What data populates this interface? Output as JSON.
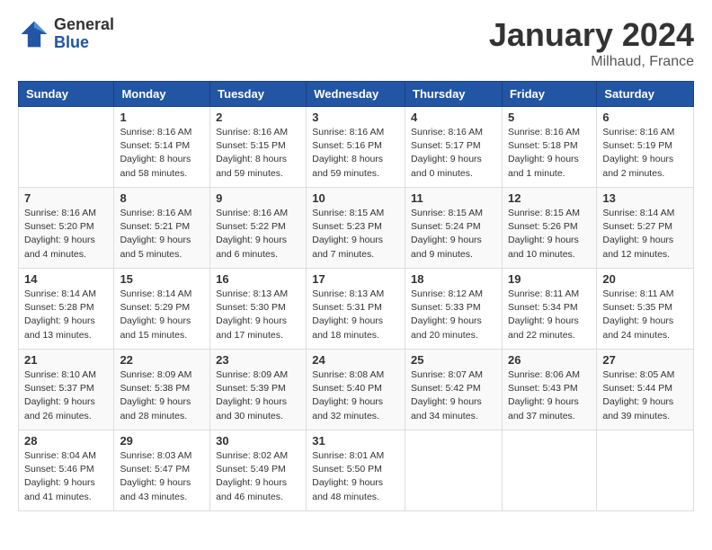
{
  "header": {
    "logo_general": "General",
    "logo_blue": "Blue",
    "month": "January 2024",
    "location": "Milhaud, France"
  },
  "weekdays": [
    "Sunday",
    "Monday",
    "Tuesday",
    "Wednesday",
    "Thursday",
    "Friday",
    "Saturday"
  ],
  "weeks": [
    [
      {
        "day": "",
        "sunrise": "",
        "sunset": "",
        "daylight": ""
      },
      {
        "day": "1",
        "sunrise": "Sunrise: 8:16 AM",
        "sunset": "Sunset: 5:14 PM",
        "daylight": "Daylight: 8 hours and 58 minutes."
      },
      {
        "day": "2",
        "sunrise": "Sunrise: 8:16 AM",
        "sunset": "Sunset: 5:15 PM",
        "daylight": "Daylight: 8 hours and 59 minutes."
      },
      {
        "day": "3",
        "sunrise": "Sunrise: 8:16 AM",
        "sunset": "Sunset: 5:16 PM",
        "daylight": "Daylight: 8 hours and 59 minutes."
      },
      {
        "day": "4",
        "sunrise": "Sunrise: 8:16 AM",
        "sunset": "Sunset: 5:17 PM",
        "daylight": "Daylight: 9 hours and 0 minutes."
      },
      {
        "day": "5",
        "sunrise": "Sunrise: 8:16 AM",
        "sunset": "Sunset: 5:18 PM",
        "daylight": "Daylight: 9 hours and 1 minute."
      },
      {
        "day": "6",
        "sunrise": "Sunrise: 8:16 AM",
        "sunset": "Sunset: 5:19 PM",
        "daylight": "Daylight: 9 hours and 2 minutes."
      }
    ],
    [
      {
        "day": "7",
        "sunrise": "Sunrise: 8:16 AM",
        "sunset": "Sunset: 5:20 PM",
        "daylight": "Daylight: 9 hours and 4 minutes."
      },
      {
        "day": "8",
        "sunrise": "Sunrise: 8:16 AM",
        "sunset": "Sunset: 5:21 PM",
        "daylight": "Daylight: 9 hours and 5 minutes."
      },
      {
        "day": "9",
        "sunrise": "Sunrise: 8:16 AM",
        "sunset": "Sunset: 5:22 PM",
        "daylight": "Daylight: 9 hours and 6 minutes."
      },
      {
        "day": "10",
        "sunrise": "Sunrise: 8:15 AM",
        "sunset": "Sunset: 5:23 PM",
        "daylight": "Daylight: 9 hours and 7 minutes."
      },
      {
        "day": "11",
        "sunrise": "Sunrise: 8:15 AM",
        "sunset": "Sunset: 5:24 PM",
        "daylight": "Daylight: 9 hours and 9 minutes."
      },
      {
        "day": "12",
        "sunrise": "Sunrise: 8:15 AM",
        "sunset": "Sunset: 5:26 PM",
        "daylight": "Daylight: 9 hours and 10 minutes."
      },
      {
        "day": "13",
        "sunrise": "Sunrise: 8:14 AM",
        "sunset": "Sunset: 5:27 PM",
        "daylight": "Daylight: 9 hours and 12 minutes."
      }
    ],
    [
      {
        "day": "14",
        "sunrise": "Sunrise: 8:14 AM",
        "sunset": "Sunset: 5:28 PM",
        "daylight": "Daylight: 9 hours and 13 minutes."
      },
      {
        "day": "15",
        "sunrise": "Sunrise: 8:14 AM",
        "sunset": "Sunset: 5:29 PM",
        "daylight": "Daylight: 9 hours and 15 minutes."
      },
      {
        "day": "16",
        "sunrise": "Sunrise: 8:13 AM",
        "sunset": "Sunset: 5:30 PM",
        "daylight": "Daylight: 9 hours and 17 minutes."
      },
      {
        "day": "17",
        "sunrise": "Sunrise: 8:13 AM",
        "sunset": "Sunset: 5:31 PM",
        "daylight": "Daylight: 9 hours and 18 minutes."
      },
      {
        "day": "18",
        "sunrise": "Sunrise: 8:12 AM",
        "sunset": "Sunset: 5:33 PM",
        "daylight": "Daylight: 9 hours and 20 minutes."
      },
      {
        "day": "19",
        "sunrise": "Sunrise: 8:11 AM",
        "sunset": "Sunset: 5:34 PM",
        "daylight": "Daylight: 9 hours and 22 minutes."
      },
      {
        "day": "20",
        "sunrise": "Sunrise: 8:11 AM",
        "sunset": "Sunset: 5:35 PM",
        "daylight": "Daylight: 9 hours and 24 minutes."
      }
    ],
    [
      {
        "day": "21",
        "sunrise": "Sunrise: 8:10 AM",
        "sunset": "Sunset: 5:37 PM",
        "daylight": "Daylight: 9 hours and 26 minutes."
      },
      {
        "day": "22",
        "sunrise": "Sunrise: 8:09 AM",
        "sunset": "Sunset: 5:38 PM",
        "daylight": "Daylight: 9 hours and 28 minutes."
      },
      {
        "day": "23",
        "sunrise": "Sunrise: 8:09 AM",
        "sunset": "Sunset: 5:39 PM",
        "daylight": "Daylight: 9 hours and 30 minutes."
      },
      {
        "day": "24",
        "sunrise": "Sunrise: 8:08 AM",
        "sunset": "Sunset: 5:40 PM",
        "daylight": "Daylight: 9 hours and 32 minutes."
      },
      {
        "day": "25",
        "sunrise": "Sunrise: 8:07 AM",
        "sunset": "Sunset: 5:42 PM",
        "daylight": "Daylight: 9 hours and 34 minutes."
      },
      {
        "day": "26",
        "sunrise": "Sunrise: 8:06 AM",
        "sunset": "Sunset: 5:43 PM",
        "daylight": "Daylight: 9 hours and 37 minutes."
      },
      {
        "day": "27",
        "sunrise": "Sunrise: 8:05 AM",
        "sunset": "Sunset: 5:44 PM",
        "daylight": "Daylight: 9 hours and 39 minutes."
      }
    ],
    [
      {
        "day": "28",
        "sunrise": "Sunrise: 8:04 AM",
        "sunset": "Sunset: 5:46 PM",
        "daylight": "Daylight: 9 hours and 41 minutes."
      },
      {
        "day": "29",
        "sunrise": "Sunrise: 8:03 AM",
        "sunset": "Sunset: 5:47 PM",
        "daylight": "Daylight: 9 hours and 43 minutes."
      },
      {
        "day": "30",
        "sunrise": "Sunrise: 8:02 AM",
        "sunset": "Sunset: 5:49 PM",
        "daylight": "Daylight: 9 hours and 46 minutes."
      },
      {
        "day": "31",
        "sunrise": "Sunrise: 8:01 AM",
        "sunset": "Sunset: 5:50 PM",
        "daylight": "Daylight: 9 hours and 48 minutes."
      },
      {
        "day": "",
        "sunrise": "",
        "sunset": "",
        "daylight": ""
      },
      {
        "day": "",
        "sunrise": "",
        "sunset": "",
        "daylight": ""
      },
      {
        "day": "",
        "sunrise": "",
        "sunset": "",
        "daylight": ""
      }
    ]
  ]
}
